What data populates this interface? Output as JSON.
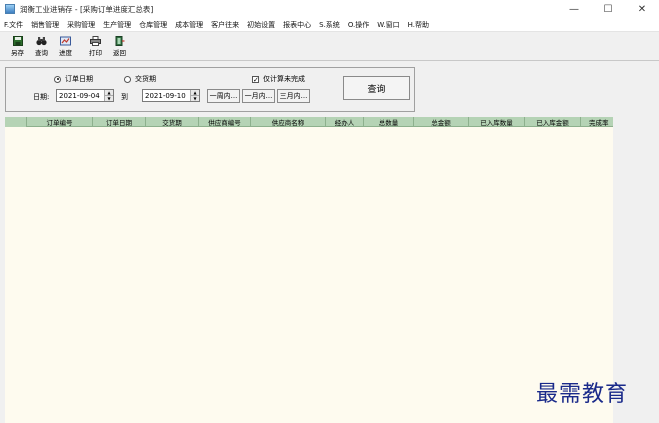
{
  "window": {
    "title": "润衡工业进销存 - [采购订单进度汇总表]",
    "controls": {
      "minimize": "—",
      "maximize": "☐",
      "close": "✕"
    }
  },
  "menu": [
    "F.文件",
    "销售管理",
    "采购管理",
    "生产管理",
    "仓库管理",
    "成本管理",
    "客户往来",
    "初始设置",
    "报表中心",
    "S.系统",
    "O.操作",
    "W.窗口",
    "H.帮助"
  ],
  "toolbar": [
    {
      "label": "另存",
      "icon": "save-icon"
    },
    {
      "label": "查询",
      "icon": "binoculars-icon"
    },
    {
      "label": "进度",
      "icon": "progress-icon"
    },
    {
      "label": "打印",
      "icon": "printer-icon"
    },
    {
      "label": "返回",
      "icon": "exit-icon"
    }
  ],
  "filters": {
    "radio_order_date": "订单日期",
    "radio_delivery_date": "交货期",
    "only_incomplete": "仅计算未完成",
    "date_label": "日期:",
    "to_label": "到",
    "date_from": "2021-09-04",
    "date_to": "2021-09-10",
    "week_btn": "一周内...",
    "month_btn": "一月内...",
    "quarter_btn": "三月内...",
    "query_btn": "查询",
    "selected_radio": "订单日期",
    "only_incomplete_checked": true
  },
  "table": {
    "columns": [
      "订单编号",
      "订单日期",
      "交货期",
      "供应商编号",
      "供应商名称",
      "经办人",
      "总数量",
      "总金额",
      "已入库数量",
      "已入库金额",
      "完成率"
    ],
    "rows": []
  },
  "watermark": "最需教育",
  "colors": {
    "header_bg": "#b5d3b5",
    "grid_bg": "#fefbef",
    "watermark": "#1a2a8a"
  }
}
